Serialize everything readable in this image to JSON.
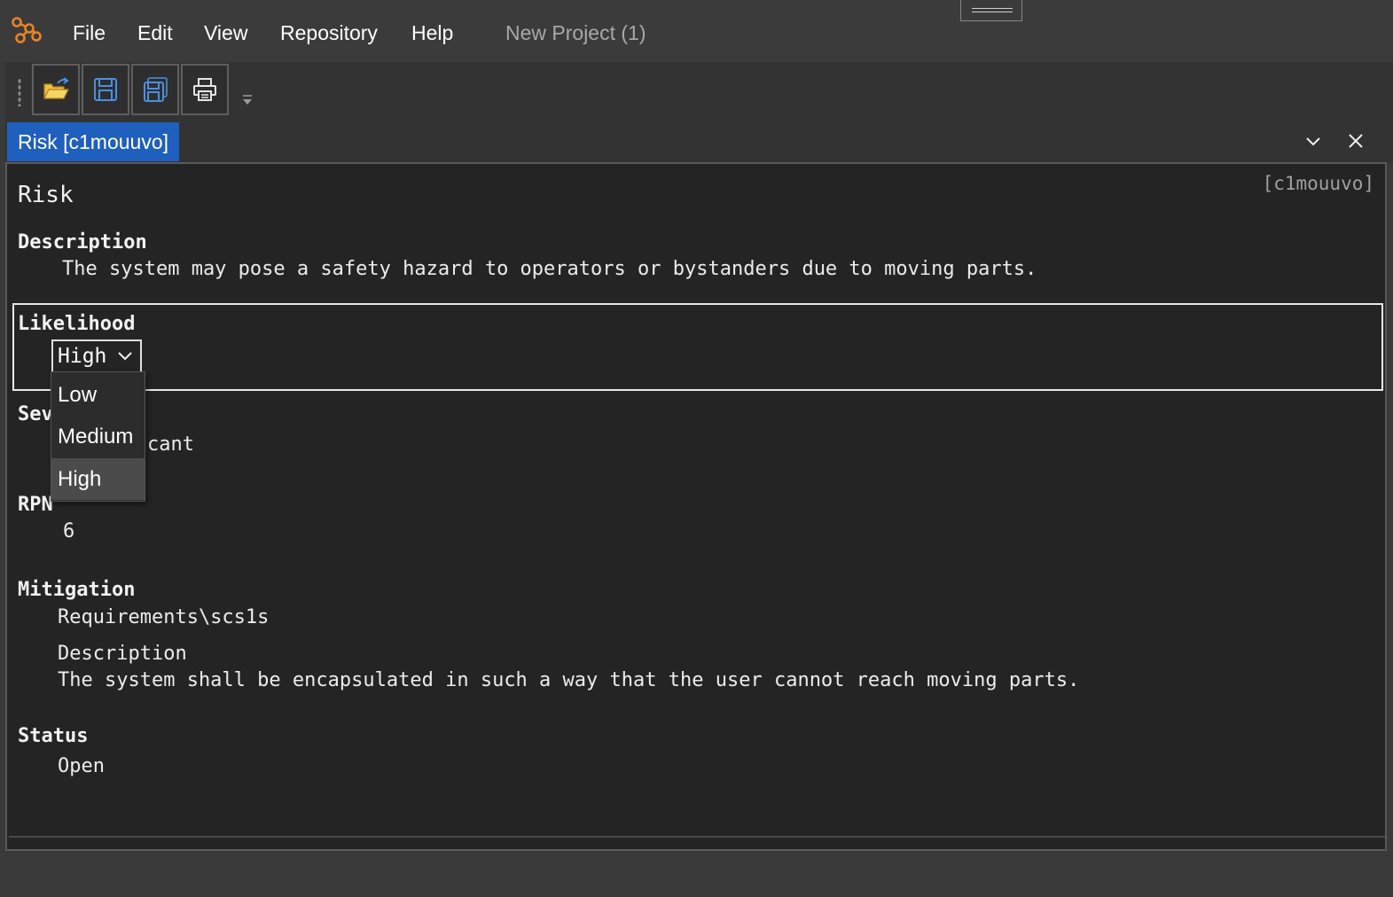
{
  "menu": {
    "items": [
      "File",
      "Edit",
      "View",
      "Repository",
      "Help"
    ],
    "project_title": "New Project (1)"
  },
  "toolbar": {
    "buttons": [
      "open-folder-icon",
      "save-icon",
      "save-all-icon",
      "print-icon"
    ]
  },
  "tab": {
    "label": "Risk [c1mouuvo]"
  },
  "document": {
    "id_tag": "[c1mouuvo]",
    "title": "Risk",
    "description_label": "Description",
    "description_value": "The system may pose a safety hazard to operators or bystanders due to moving parts.",
    "likelihood_label": "Likelihood",
    "likelihood_selected": "High",
    "severity_label_visible": "Sev",
    "severity_value_visible": "cant",
    "rpn_label": "RPN",
    "rpn_value": "6",
    "mitigation_label": "Mitigation",
    "mitigation_path": "Requirements\\scs1s",
    "mitigation_desc_label": "Description",
    "mitigation_desc_value": "The system shall be encapsulated in such a way that the user cannot reach moving parts.",
    "status_label": "Status",
    "status_value": "Open"
  },
  "likelihood_dropdown": {
    "options": [
      "Low",
      "Medium",
      "High"
    ],
    "highlighted": "High"
  },
  "colors": {
    "accent_tab": "#1f5fbd",
    "background": "#242424",
    "chrome": "#3b3b3b",
    "logo": "#e8832a"
  }
}
